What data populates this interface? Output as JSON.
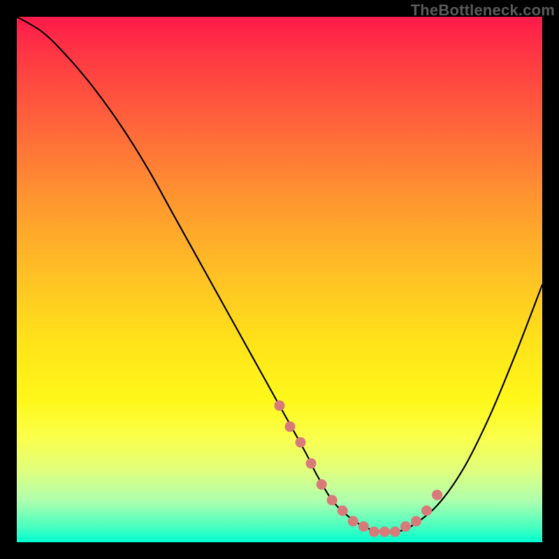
{
  "watermark": "TheBottleneck.com",
  "chart_data": {
    "type": "line",
    "title": "",
    "xlabel": "",
    "ylabel": "",
    "xlim": [
      0,
      100
    ],
    "ylim": [
      0,
      100
    ],
    "series": [
      {
        "name": "bottleneck-curve",
        "x": [
          0,
          5,
          10,
          15,
          20,
          25,
          30,
          35,
          40,
          45,
          50,
          55,
          57,
          60,
          63,
          66,
          69,
          72,
          75,
          80,
          85,
          90,
          95,
          100
        ],
        "y": [
          100,
          97,
          92,
          86,
          79,
          71,
          62,
          53,
          44,
          35,
          26,
          17,
          13,
          8,
          5,
          3,
          2,
          2,
          3,
          7,
          14,
          24,
          36,
          49
        ]
      }
    ],
    "markers": {
      "name": "highlight-dots",
      "color": "#d97a7a",
      "x": [
        50,
        52,
        54,
        56,
        58,
        60,
        62,
        64,
        66,
        68,
        70,
        72,
        74,
        76,
        78,
        80
      ],
      "y": [
        26,
        22,
        19,
        15,
        11,
        8,
        6,
        4,
        3,
        2,
        2,
        2,
        3,
        4,
        6,
        9
      ]
    }
  }
}
